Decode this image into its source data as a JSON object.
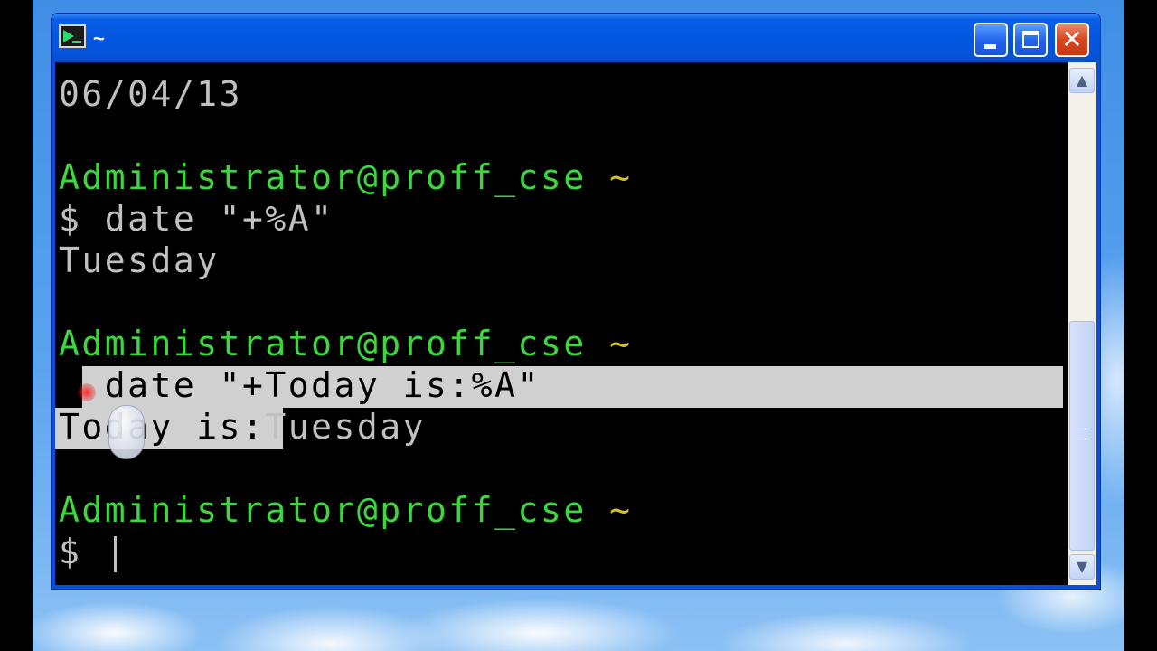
{
  "window": {
    "title": "~",
    "controls": {
      "minimize_icon": "minimize-icon",
      "maximize_icon": "maximize-icon",
      "close_label": "✕"
    }
  },
  "terminal": {
    "lines": [
      {
        "text": "06/04/13"
      },
      {
        "user": "Administrator@proff_cse",
        "tilde": "~"
      },
      {
        "text": "$ date \"+%A\""
      },
      {
        "text": "Tuesday"
      },
      {
        "user": "Administrator@proff_cse",
        "tilde": "~"
      },
      {
        "text": "$ date \"+Today is:%A\""
      },
      {
        "selected": "Today is:",
        "rest": "Tuesday"
      },
      {
        "user": "Administrator@proff_cse",
        "tilde": "~"
      },
      {
        "text": "$ "
      }
    ]
  },
  "scrollbar": {
    "up": "▲",
    "down": "▼"
  },
  "colors": {
    "prompt_user": "#3ed63e",
    "prompt_tilde": "#d6c21e",
    "output_text": "#c0c0c0",
    "selection": "#d0d0d0",
    "titlebar": "#0356e0"
  }
}
